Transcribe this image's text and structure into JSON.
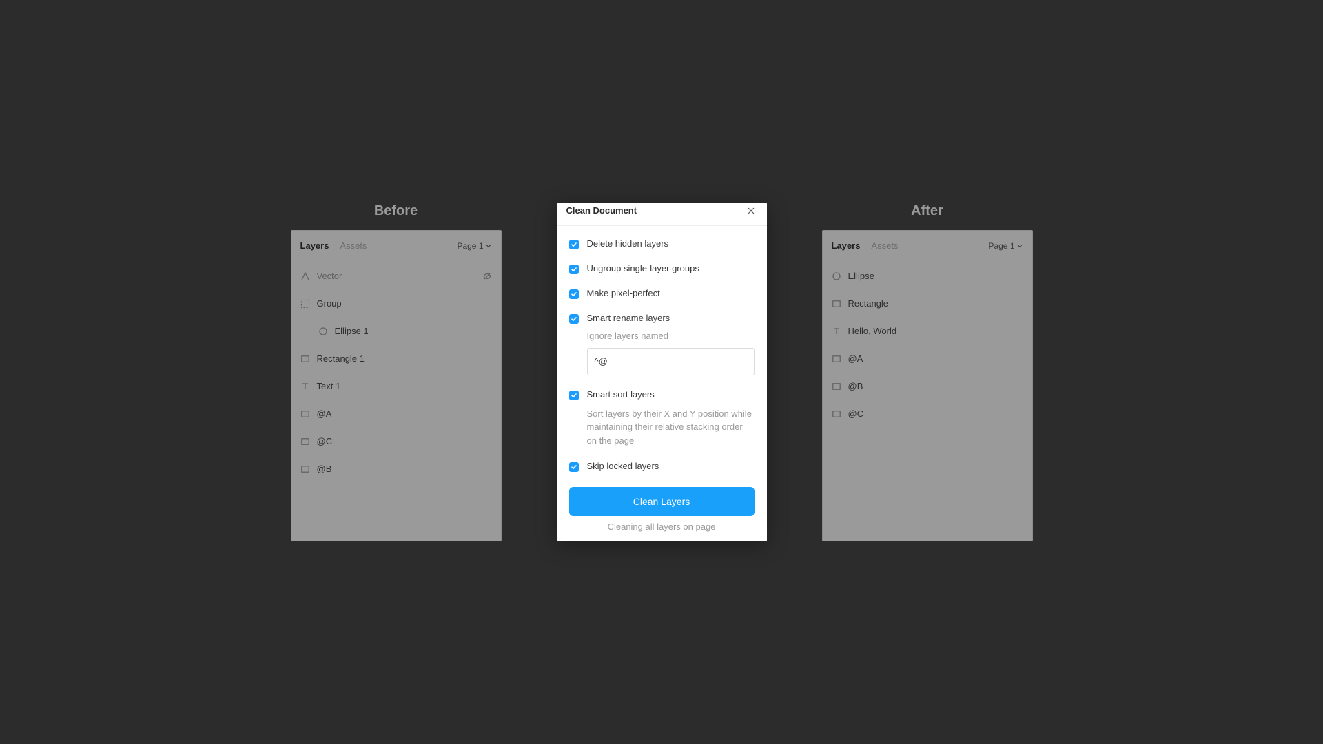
{
  "labels": {
    "before": "Before",
    "after": "After"
  },
  "tabs": {
    "layers": "Layers",
    "assets": "Assets"
  },
  "page_selector": "Page 1",
  "before_layers": [
    {
      "icon": "vector",
      "name": "Vector",
      "indent": false,
      "faded": true,
      "trail": "hidden"
    },
    {
      "icon": "group",
      "name": "Group",
      "indent": false
    },
    {
      "icon": "ellipse",
      "name": "Ellipse 1",
      "indent": true
    },
    {
      "icon": "rectangle",
      "name": "Rectangle 1",
      "indent": false
    },
    {
      "icon": "text",
      "name": "Text 1",
      "indent": false
    },
    {
      "icon": "rectangle",
      "name": "@A",
      "indent": false
    },
    {
      "icon": "rectangle",
      "name": "@C",
      "indent": false
    },
    {
      "icon": "rectangle",
      "name": "@B",
      "indent": false
    }
  ],
  "after_layers": [
    {
      "icon": "ellipse",
      "name": "Ellipse",
      "indent": false
    },
    {
      "icon": "rectangle",
      "name": "Rectangle",
      "indent": false
    },
    {
      "icon": "text",
      "name": "Hello, World",
      "indent": false
    },
    {
      "icon": "rectangle",
      "name": "@A",
      "indent": false
    },
    {
      "icon": "rectangle",
      "name": "@B",
      "indent": false
    },
    {
      "icon": "rectangle",
      "name": "@C",
      "indent": false
    }
  ],
  "dialog": {
    "title": "Clean Document",
    "options": {
      "delete_hidden": "Delete hidden layers",
      "ungroup_single": "Ungroup single-layer groups",
      "pixel_perfect": "Make pixel-perfect",
      "smart_rename": "Smart rename layers",
      "ignore_label": "Ignore layers named",
      "ignore_value": "^@",
      "smart_sort": "Smart sort layers",
      "sort_desc": "Sort layers by their X and Y position while maintaining their relative stacking order on the page",
      "skip_locked": "Skip locked layers"
    },
    "action_label": "Clean Layers",
    "status": "Cleaning all layers on page"
  },
  "colors": {
    "accent": "#18a0fb",
    "dialog_bg": "#ffffff",
    "stage_bg": "#2c2c2c",
    "panel_bg": "#9a9a9a"
  }
}
